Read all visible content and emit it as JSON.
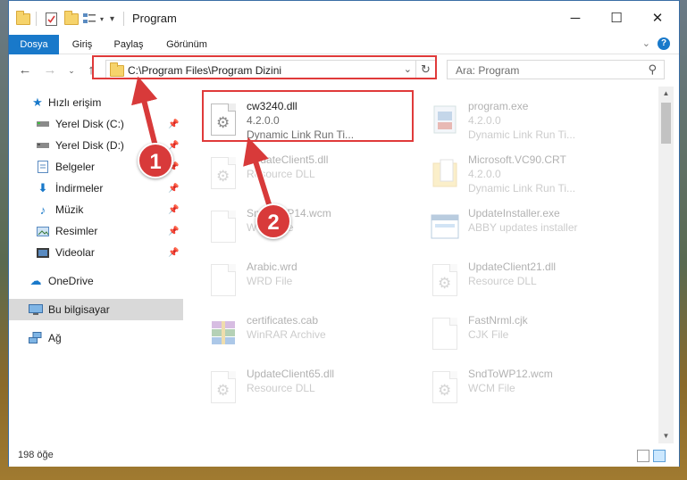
{
  "window": {
    "title": "Program"
  },
  "ribbon": {
    "tabs": [
      "Dosya",
      "Giriş",
      "Paylaş",
      "Görünüm"
    ]
  },
  "address": {
    "path": "C:\\Program Files\\Program Dizini"
  },
  "search": {
    "placeholder": "Ara: Program"
  },
  "navigation": {
    "items": [
      {
        "label": "Hızlı erişim",
        "icon": "star-icon",
        "pinned": false
      },
      {
        "label": "Yerel Disk (C:)",
        "icon": "drive-icon",
        "pinned": true
      },
      {
        "label": "Yerel Disk (D:)",
        "icon": "drive-icon",
        "pinned": true
      },
      {
        "label": "Belgeler",
        "icon": "documents-icon",
        "pinned": true
      },
      {
        "label": "İndirmeler",
        "icon": "download-icon",
        "pinned": true
      },
      {
        "label": "Müzik",
        "icon": "music-icon",
        "pinned": true
      },
      {
        "label": "Resimler",
        "icon": "pictures-icon",
        "pinned": true
      },
      {
        "label": "Videolar",
        "icon": "videos-icon",
        "pinned": true
      },
      {
        "label": "OneDrive",
        "icon": "cloud-icon",
        "pinned": false
      },
      {
        "label": "Bu bilgisayar",
        "icon": "computer-icon",
        "pinned": false,
        "selected": true
      },
      {
        "label": "Ağ",
        "icon": "network-icon",
        "pinned": false
      }
    ]
  },
  "files": [
    {
      "name": "cw3240.dll",
      "line1": "4.2.0.0",
      "line2": "Dynamic Link Run Ti...",
      "icon": "dll-icon",
      "highlighted": true
    },
    {
      "name": "program.exe",
      "line1": "4.2.0.0",
      "line2": "Dynamic Link Run Ti...",
      "icon": "exe-icon"
    },
    {
      "name": "UpdateClient5.dll",
      "line1": "Resource DLL",
      "line2": "",
      "icon": "dll-icon"
    },
    {
      "name": "Microsoft.VC90.CRT",
      "line1": "4.2.0.0",
      "line2": "Dynamic Link Run Ti...",
      "icon": "folder-icon"
    },
    {
      "name": "SndToWP14.wcm",
      "line1": "WCM File",
      "line2": "",
      "icon": "file-icon"
    },
    {
      "name": "UpdateInstaller.exe",
      "line1": "ABBY updates installer",
      "line2": "",
      "icon": "installer-icon"
    },
    {
      "name": "Arabic.wrd",
      "line1": "WRD File",
      "line2": "",
      "icon": "file-icon"
    },
    {
      "name": "UpdateClient21.dll",
      "line1": "Resource DLL",
      "line2": "",
      "icon": "dll-icon"
    },
    {
      "name": "certificates.cab",
      "line1": "WinRAR Archive",
      "line2": "",
      "icon": "archive-icon"
    },
    {
      "name": "FastNrml.cjk",
      "line1": "CJK File",
      "line2": "",
      "icon": "file-icon"
    },
    {
      "name": "UpdateClient65.dll",
      "line1": "Resource DLL",
      "line2": "",
      "icon": "dll-icon"
    },
    {
      "name": "SndToWP12.wcm",
      "line1": "WCM File",
      "line2": "",
      "icon": "file-icon"
    }
  ],
  "status": {
    "count": "198 öğe"
  },
  "callouts": [
    "1",
    "2"
  ],
  "colors": {
    "accent": "#1979ca",
    "highlight": "#e03a3a",
    "callout": "#d83a3a"
  }
}
